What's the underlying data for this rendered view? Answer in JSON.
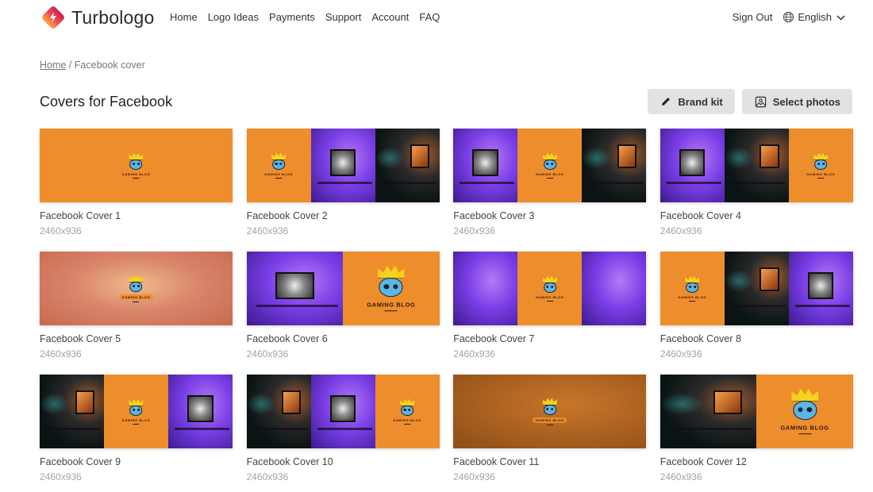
{
  "header": {
    "brand_name": "Turbologo",
    "nav": [
      "Home",
      "Logo Ideas",
      "Payments",
      "Support",
      "Account",
      "FAQ"
    ],
    "sign_out": "Sign Out",
    "language": "English",
    "icons": {
      "language": "globe-icon",
      "dropdown": "chevron-down-icon"
    }
  },
  "breadcrumb": {
    "home": "Home",
    "separator": "/",
    "current": "Facebook cover"
  },
  "page": {
    "title": "Covers for Facebook",
    "actions": {
      "brand_kit": "Brand kit",
      "select_photos": "Select photos"
    }
  },
  "theme": {
    "accent_orange": "#ee8d2c",
    "button_bg": "#e2e2e2"
  },
  "logo_text": "GAMING BLOG",
  "covers": [
    {
      "title": "Facebook Cover 1",
      "size": "2460x936"
    },
    {
      "title": "Facebook Cover 2",
      "size": "2460x936"
    },
    {
      "title": "Facebook Cover 3",
      "size": "2460x936"
    },
    {
      "title": "Facebook Cover 4",
      "size": "2460x936"
    },
    {
      "title": "Facebook Cover 5",
      "size": "2460x936"
    },
    {
      "title": "Facebook Cover 6",
      "size": "2460x936"
    },
    {
      "title": "Facebook Cover 7",
      "size": "2460x936"
    },
    {
      "title": "Facebook Cover 8",
      "size": "2460x936"
    },
    {
      "title": "Facebook Cover 9",
      "size": "2460x936"
    },
    {
      "title": "Facebook Cover 10",
      "size": "2460x936"
    },
    {
      "title": "Facebook Cover 11",
      "size": "2460x936"
    },
    {
      "title": "Facebook Cover 12",
      "size": "2460x936"
    }
  ]
}
